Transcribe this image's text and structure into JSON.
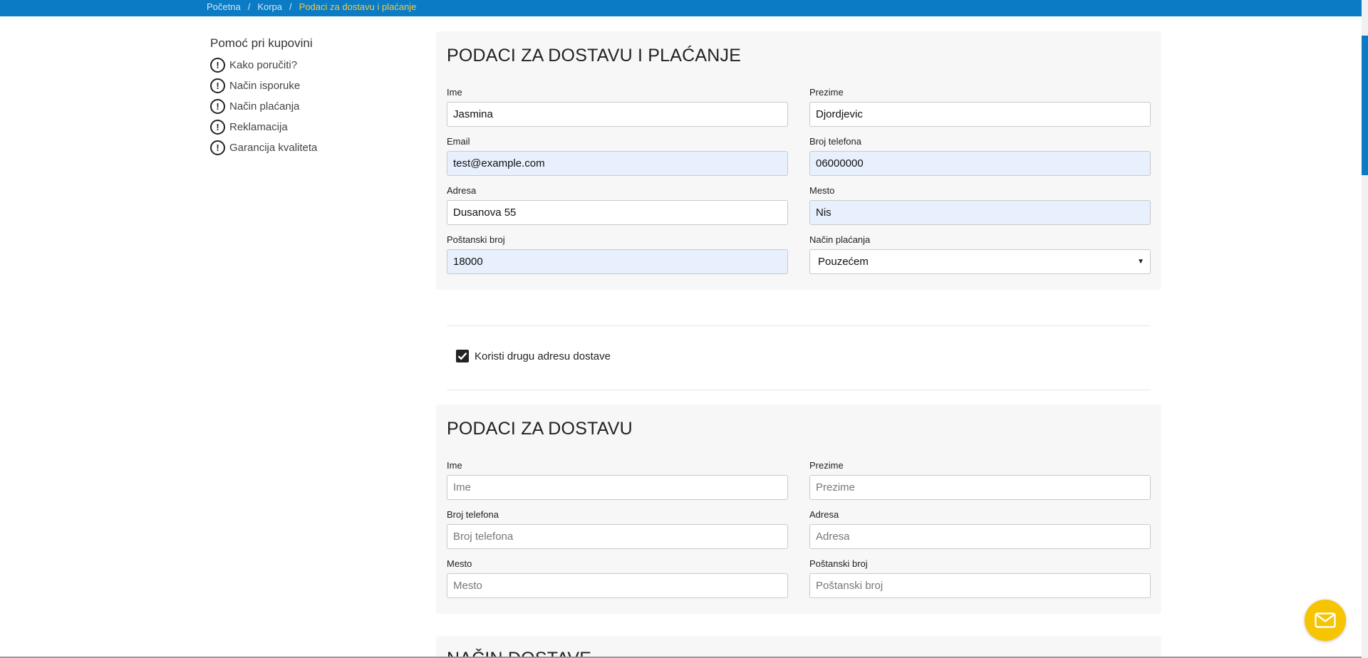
{
  "breadcrumb": {
    "items": [
      "Početna",
      "Korpa"
    ],
    "separator": "/",
    "current": "Podaci za dostavu i plaćanje"
  },
  "sidebar": {
    "title": "Pomoć pri kupovini",
    "items": [
      {
        "label": "Kako poručiti?",
        "icon": "exclamation-circle-icon"
      },
      {
        "label": "Način isporuke",
        "icon": "exclamation-circle-icon"
      },
      {
        "label": "Način plaćanja",
        "icon": "exclamation-circle-icon"
      },
      {
        "label": "Reklamacija",
        "icon": "exclamation-circle-icon"
      },
      {
        "label": "Garancija kvaliteta",
        "icon": "exclamation-circle-icon"
      }
    ]
  },
  "billing": {
    "title": "PODACI ZA DOSTAVU I PLAĆANJE",
    "first_name": {
      "label": "Ime",
      "value": "Jasmina"
    },
    "last_name": {
      "label": "Prezime",
      "value": "Djordjevic"
    },
    "email": {
      "label": "Email",
      "value": "test@example.com"
    },
    "phone": {
      "label": "Broj telefona",
      "value": "06000000"
    },
    "address": {
      "label": "Adresa",
      "value": "Dusanova 55"
    },
    "city": {
      "label": "Mesto",
      "value": "Nis"
    },
    "postal_code": {
      "label": "Poštanski broj",
      "value": "18000"
    },
    "payment_method": {
      "label": "Način plaćanja",
      "value": "Pouzećem"
    }
  },
  "alt_address_checkbox": {
    "label": "Koristi drugu adresu dostave",
    "checked": true
  },
  "delivery": {
    "title": "PODACI ZA DOSTAVU",
    "first_name": {
      "label": "Ime",
      "placeholder": "Ime"
    },
    "last_name": {
      "label": "Prezime",
      "placeholder": "Prezime"
    },
    "phone": {
      "label": "Broj telefona",
      "placeholder": "Broj telefona"
    },
    "address": {
      "label": "Adresa",
      "placeholder": "Adresa"
    },
    "city": {
      "label": "Mesto",
      "placeholder": "Mesto"
    },
    "postal_code": {
      "label": "Poštanski broj",
      "placeholder": "Poštanski broj"
    }
  },
  "shipping_method": {
    "title": "NAČIN DOSTAVE"
  },
  "colors": {
    "brand_blue": "#0a7bc4",
    "accent_yellow": "#f6c400",
    "autofill_bg": "#e8f0fe"
  },
  "floating_button": {
    "icon": "mail-icon"
  }
}
